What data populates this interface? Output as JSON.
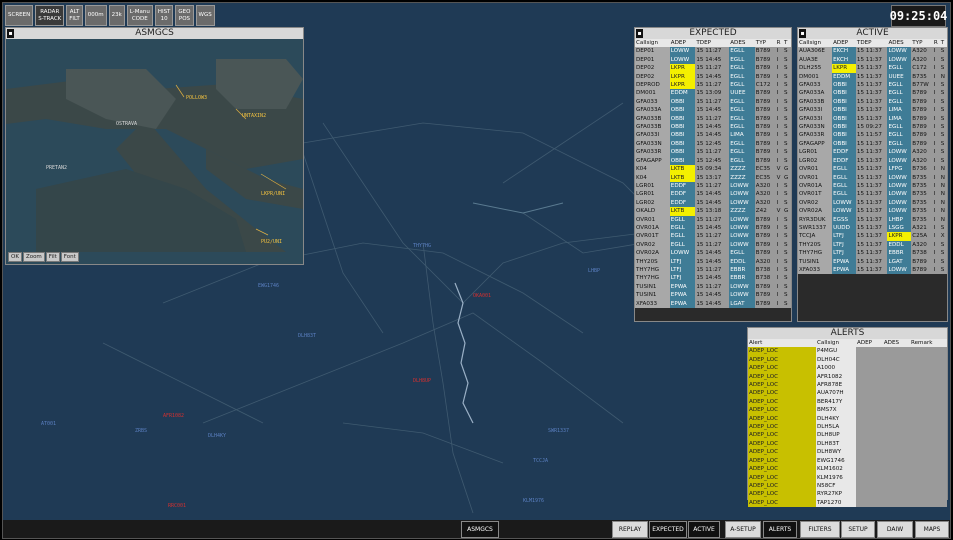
{
  "toolbar": {
    "buttons": [
      {
        "l1": "SCREEN",
        "l2": ""
      },
      {
        "l1": "RADAR",
        "l2": "S-TRACK"
      },
      {
        "l1": "ALT",
        "l2": "FILT"
      },
      {
        "l1": "000m",
        "l2": ""
      },
      {
        "l1": "23k",
        "l2": ""
      },
      {
        "l1": "L-Manu",
        "l2": "CODE"
      },
      {
        "l1": "HIST",
        "l2": "10"
      },
      {
        "l1": "GEO",
        "l2": "POS"
      },
      {
        "l1": "WGS",
        "l2": ""
      }
    ]
  },
  "clock": "09:25:04",
  "asmgcs": {
    "title": "ASMGCS",
    "labels": [
      "POLLOW3",
      "UNTAXIN2",
      "OSTRAVA",
      "PRETAN2",
      "LKPR/UNI",
      "PU2/UNI"
    ],
    "buttons": [
      "OK",
      "Zoom",
      "Filt",
      "Font"
    ]
  },
  "expected": {
    "title": "EXPECTED",
    "headers": [
      "Callsign",
      "ADEP",
      "TDEP",
      "ADES",
      "TYP",
      "R",
      "T"
    ],
    "rows": [
      [
        "DEP01",
        "LOWW",
        "15 11:27",
        "EGLL",
        "B789",
        "I",
        "S"
      ],
      [
        "DEP01",
        "LOWW",
        "15 14:45",
        "EGLL",
        "B789",
        "I",
        "S"
      ],
      [
        "DEP02",
        "LKPR",
        "15 11:27",
        "EGLL",
        "B789",
        "I",
        "S"
      ],
      [
        "DEP02",
        "LKPR",
        "15 14:45",
        "EGLL",
        "B789",
        "I",
        "S"
      ],
      [
        "DEPROD",
        "LKPR",
        "15 11:27",
        "EGLL",
        "C172",
        "I",
        "S"
      ],
      [
        "DM001",
        "EDDM",
        "15 13:09",
        "UUEE",
        "B789",
        "I",
        "S"
      ],
      [
        "GFA033",
        "OBBI",
        "15 11:27",
        "EGLL",
        "B789",
        "I",
        "S"
      ],
      [
        "GFA033A",
        "OBBI",
        "15 14:45",
        "EGLL",
        "B789",
        "I",
        "S"
      ],
      [
        "GFA033B",
        "OBBI",
        "15 11:27",
        "EGLL",
        "B789",
        "I",
        "S"
      ],
      [
        "GFA033B",
        "OBBI",
        "15 14:45",
        "EGLL",
        "B789",
        "I",
        "S"
      ],
      [
        "GFA033I",
        "OBBI",
        "15 14:45",
        "LIMA",
        "B789",
        "I",
        "S"
      ],
      [
        "GFA033N",
        "OBBI",
        "15 12:45",
        "EGLL",
        "B789",
        "I",
        "S"
      ],
      [
        "GFA033R",
        "OBBI",
        "15 11:27",
        "EGLL",
        "B789",
        "I",
        "S"
      ],
      [
        "GFAGAPP",
        "OBBI",
        "15 12:45",
        "EGLL",
        "B789",
        "I",
        "S"
      ],
      [
        "K04",
        "LKTB",
        "15 09:34",
        "ZZZZ",
        "EC35",
        "V",
        "G"
      ],
      [
        "K04",
        "LKTB",
        "15 13:17",
        "ZZZZ",
        "EC35",
        "V",
        "G"
      ],
      [
        "LGR01",
        "EDDF",
        "15 11:27",
        "LOWW",
        "A320",
        "I",
        "S"
      ],
      [
        "LGR01",
        "EDDF",
        "15 14:45",
        "LOWW",
        "A320",
        "I",
        "S"
      ],
      [
        "LGR02",
        "EDDF",
        "15 14:45",
        "LOWW",
        "A320",
        "I",
        "S"
      ],
      [
        "OKALD",
        "LKTB",
        "15 13:18",
        "ZZZZ",
        "Z42",
        "V",
        "G"
      ],
      [
        "OVR01",
        "EGLL",
        "15 11:27",
        "LOWW",
        "B789",
        "I",
        "S"
      ],
      [
        "OVR01A",
        "EGLL",
        "15 14:45",
        "LOWW",
        "B789",
        "I",
        "S"
      ],
      [
        "OVR01T",
        "EGLL",
        "15 11:27",
        "LOWW",
        "B789",
        "I",
        "S"
      ],
      [
        "OVR02",
        "EGLL",
        "15 11:27",
        "LOWW",
        "B789",
        "I",
        "S"
      ],
      [
        "OVR02A",
        "LOWW",
        "15 14:45",
        "EGLL",
        "B789",
        "I",
        "S"
      ],
      [
        "THY20S",
        "LTFJ",
        "15 14:45",
        "EDDL",
        "A320",
        "I",
        "S"
      ],
      [
        "THY7HG",
        "LTFJ",
        "15 11:27",
        "EBBR",
        "B738",
        "I",
        "S"
      ],
      [
        "THY7HG",
        "LTFJ",
        "15 14:45",
        "EBBR",
        "B738",
        "I",
        "S"
      ],
      [
        "TUSIN1",
        "EPWA",
        "15 11:27",
        "LOWW",
        "B789",
        "I",
        "S"
      ],
      [
        "TUSIN1",
        "EPWA",
        "15 14:45",
        "LOWW",
        "B789",
        "I",
        "S"
      ],
      [
        "XFA033",
        "EPWA",
        "15 14:45",
        "LGAT",
        "B789",
        "I",
        "S"
      ]
    ],
    "highlight_adep": [
      2,
      3,
      4,
      14,
      15,
      19
    ]
  },
  "active": {
    "title": "ACTIVE",
    "headers": [
      "Callsign",
      "ADEP",
      "TDEP",
      "ADES",
      "TYP",
      "R",
      "T"
    ],
    "rows": [
      [
        "AUA306E",
        "EKCH",
        "15 11:37",
        "LOWW",
        "A320",
        "I",
        "S"
      ],
      [
        "AUA3E",
        "EKCH",
        "15 11:37",
        "LOWW",
        "A320",
        "I",
        "S"
      ],
      [
        "DLH255",
        "LKPR",
        "15 11:37",
        "EGLL",
        "C172",
        "I",
        "S"
      ],
      [
        "DM001",
        "EDDM",
        "15 11:37",
        "UUEE",
        "B735",
        "I",
        "N"
      ],
      [
        "GFA033",
        "OBBI",
        "15 11:37",
        "EGLL",
        "B77W",
        "I",
        "S"
      ],
      [
        "GFA033A",
        "OBBI",
        "15 11:37",
        "EGLL",
        "B789",
        "I",
        "S"
      ],
      [
        "GFA033B",
        "OBBI",
        "15 11:37",
        "EGLL",
        "B789",
        "I",
        "S"
      ],
      [
        "GFA033I",
        "OBBI",
        "15 11:37",
        "LIMA",
        "B789",
        "I",
        "S"
      ],
      [
        "GFA033I",
        "OBBI",
        "15 11:37",
        "LIMA",
        "B789",
        "I",
        "S"
      ],
      [
        "GFA033N",
        "OBBI",
        "15 09:27",
        "EGLL",
        "B789",
        "I",
        "S"
      ],
      [
        "GFA033R",
        "OBBI",
        "15 11:57",
        "EGLL",
        "B789",
        "I",
        "S"
      ],
      [
        "GFAGAPP",
        "OBBI",
        "15 11:37",
        "EGLL",
        "B789",
        "I",
        "S"
      ],
      [
        "LGR01",
        "EDDF",
        "15 11:37",
        "LOWW",
        "A320",
        "I",
        "S"
      ],
      [
        "LGR02",
        "EDDF",
        "15 11:37",
        "LOWW",
        "A320",
        "I",
        "S"
      ],
      [
        "OVR01",
        "EGLL",
        "15 11:37",
        "LFPG",
        "B736",
        "I",
        "N"
      ],
      [
        "OVR01",
        "EGLL",
        "15 11:37",
        "LOWW",
        "B735",
        "I",
        "N"
      ],
      [
        "OVR01A",
        "EGLL",
        "15 11:37",
        "LOWW",
        "B735",
        "I",
        "N"
      ],
      [
        "OVR01T",
        "EGLL",
        "15 11:37",
        "LOWW",
        "B735",
        "I",
        "N"
      ],
      [
        "OVR02",
        "LOWW",
        "15 11:37",
        "LOWW",
        "B735",
        "I",
        "N"
      ],
      [
        "OVR02A",
        "LOWW",
        "15 11:37",
        "LOWW",
        "B735",
        "I",
        "N"
      ],
      [
        "RYR3DUK",
        "EGSS",
        "15 11:37",
        "LHBP",
        "B735",
        "I",
        "N"
      ],
      [
        "SWR1337",
        "UUDD",
        "15 11:37",
        "LSGG",
        "A321",
        "I",
        "S"
      ],
      [
        "TCCJA",
        "LTFJ",
        "15 11:37",
        "LKPR",
        "C25A",
        "I",
        "X"
      ],
      [
        "THY20S",
        "LTFJ",
        "15 11:37",
        "EDDL",
        "A320",
        "I",
        "S"
      ],
      [
        "THY7HG",
        "LTFJ",
        "15 11:37",
        "EBBR",
        "B738",
        "I",
        "S"
      ],
      [
        "TUSIN1",
        "EPWA",
        "15 11:37",
        "LGAT",
        "B789",
        "I",
        "S"
      ],
      [
        "XFA033",
        "EPWA",
        "15 11:37",
        "LOWW",
        "B789",
        "I",
        "S"
      ]
    ],
    "highlight_adep": [
      2
    ],
    "highlight_ades": [
      22
    ]
  },
  "alerts": {
    "title": "ALERTS",
    "headers": [
      "Alert",
      "Callsign",
      "ADEP",
      "ADES",
      "Remark"
    ],
    "rows": [
      [
        "ADEP_LOC",
        "P4MGU"
      ],
      [
        "ADEP_LOC",
        "DLH04C"
      ],
      [
        "ADEP_LOC",
        "A1000"
      ],
      [
        "ADEP_LOC",
        "AFR1082"
      ],
      [
        "ADEP_LOC",
        "AFR878E"
      ],
      [
        "ADEP_LOC",
        "AUA707H"
      ],
      [
        "ADEP_LOC",
        "BER417Y"
      ],
      [
        "ADEP_LOC",
        "BMS7X"
      ],
      [
        "ADEP_LOC",
        "DLH4KY"
      ],
      [
        "ADEP_LOC",
        "DLH5LA"
      ],
      [
        "ADEP_LOC",
        "DLH8UP"
      ],
      [
        "ADEP_LOC",
        "DLH83T"
      ],
      [
        "ADEP_LOC",
        "DLH8WY"
      ],
      [
        "ADEP_LOC",
        "EWG1746"
      ],
      [
        "ADEP_LOC",
        "KLM1602"
      ],
      [
        "ADEP_LOC",
        "KLM1976"
      ],
      [
        "ADEP_LOC",
        "N58CF"
      ],
      [
        "ADEP_LOC",
        "RYR27KP"
      ],
      [
        "ADEP_LOC",
        "TAP1270"
      ]
    ]
  },
  "map_labels": [
    {
      "t": "LHBP",
      "c": "blue"
    },
    {
      "t": "OKA001",
      "c": "red"
    },
    {
      "t": "THY7HG",
      "c": "blue"
    },
    {
      "t": "DLH8UP",
      "c": "red"
    },
    {
      "t": "SWR1337",
      "c": "blue"
    },
    {
      "t": "TCCJA",
      "c": "blue"
    },
    {
      "t": "AFR1082",
      "c": "red"
    },
    {
      "t": "DLH4KY",
      "c": "blue"
    },
    {
      "t": "AT001",
      "c": "blue"
    },
    {
      "t": "ZRBS",
      "c": "blue"
    },
    {
      "t": "RRC001",
      "c": "red"
    },
    {
      "t": "EWG1746",
      "c": "blue"
    },
    {
      "t": "KLM1976",
      "c": "blue"
    },
    {
      "t": "DLH83T",
      "c": "blue"
    }
  ],
  "bottom": {
    "asmgcs": "ASMGCS",
    "buttons": [
      "REPLAY",
      "EXPECTED",
      "ACTIVE",
      "A-SETUP",
      "ALERTS",
      "FILTERS",
      "SETUP",
      "DAIW",
      "MAPS"
    ]
  }
}
